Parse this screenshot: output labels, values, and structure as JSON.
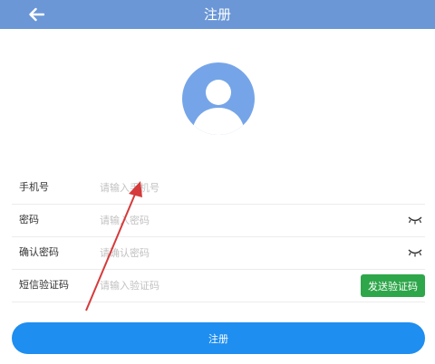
{
  "header": {
    "title": "注册",
    "back_icon": "back-arrow-icon",
    "background_color": "#6b97d6"
  },
  "avatar": {
    "icon": "user-avatar-icon",
    "color": "#75a5e8"
  },
  "form": {
    "phone": {
      "label": "手机号",
      "placeholder": "请输入手机号"
    },
    "password": {
      "label": "密码",
      "placeholder": "请输入密码",
      "toggle_icon": "eye-closed-icon"
    },
    "confirm_password": {
      "label": "确认密码",
      "placeholder": "请确认密码",
      "toggle_icon": "eye-closed-icon"
    },
    "sms_code": {
      "label": "短信验证码",
      "placeholder": "请输入验证码",
      "send_button": "发送验证码",
      "send_button_color": "#2ea64a"
    }
  },
  "submit": {
    "label": "注册",
    "color": "#1e8ef0"
  },
  "annotation": {
    "icon": "red-pointer-arrow",
    "color": "#d63a3a"
  }
}
